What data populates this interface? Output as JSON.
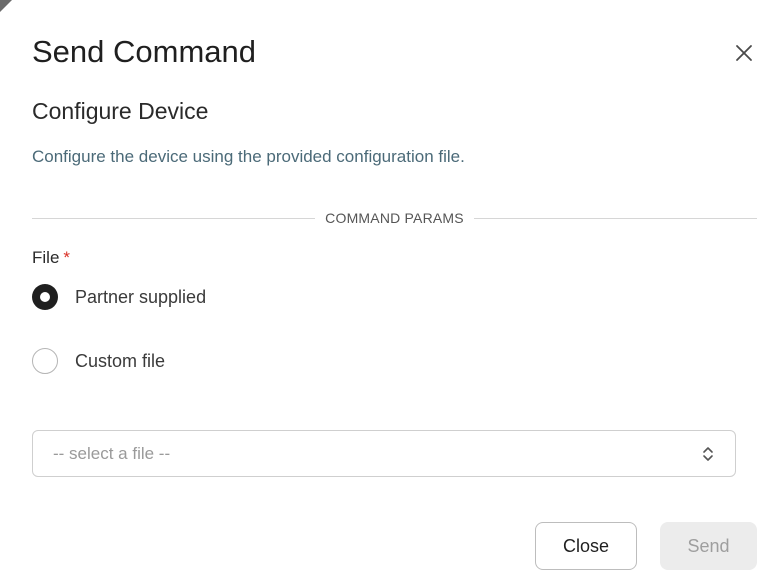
{
  "dialog": {
    "title": "Send Command",
    "subtitle": "Configure Device",
    "description": "Configure the device using the provided configuration file.",
    "section_label": "COMMAND PARAMS",
    "close_icon": "close-icon"
  },
  "form": {
    "file_label": "File",
    "required_marker": "*",
    "options": [
      {
        "label": "Partner supplied",
        "selected": true
      },
      {
        "label": "Custom file",
        "selected": false
      }
    ],
    "select": {
      "value": "-- select a file --",
      "icon": "chevron-up-down-icon"
    }
  },
  "actions": {
    "close_label": "Close",
    "send_label": "Send",
    "send_disabled": true
  },
  "colors": {
    "required": "#d93025",
    "description": "#4b6a78",
    "radio_checked": "#1f1f1f",
    "disabled_bg": "#ececec"
  }
}
